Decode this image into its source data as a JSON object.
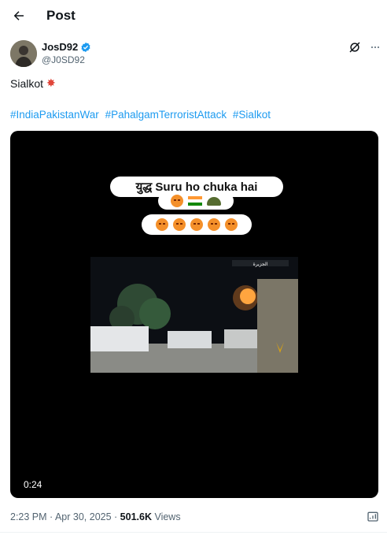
{
  "topbar": {
    "title": "Post"
  },
  "author": {
    "display_name": "JosD92",
    "handle": "@J0SD92",
    "verified": true
  },
  "post": {
    "text": "Sialkot",
    "hashtags": [
      "#IndiaPakistanWar",
      "#PahalgamTerroristAttack",
      "#Sialkot"
    ]
  },
  "video": {
    "overlay_text": "युद्ध Suru ho  chuka hai",
    "duration": "0:24",
    "channel_caption": "الجزيرة"
  },
  "meta": {
    "timestamp": "2:23 PM · Apr 30, 2025 · ",
    "views_count": "501.6K",
    "views_label": " Views"
  },
  "icons": {
    "back": "arrow-left-icon",
    "verified": "verified-badge-icon",
    "grok": "grok-icon",
    "more": "more-icon",
    "bookmark": "analytics-icon",
    "collision": "collision-emoji"
  },
  "colors": {
    "accent": "#1d9bf0",
    "text": "#0f1419",
    "secondary": "#536471",
    "video_bg": "#000000"
  }
}
